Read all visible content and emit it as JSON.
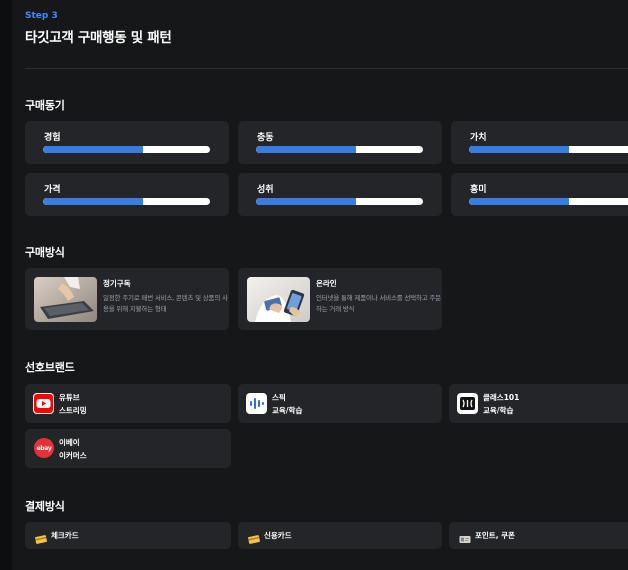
{
  "header": {
    "step": "Step 3",
    "title": "타깃고객 구매행동 및 패턴"
  },
  "motives": {
    "title": "구매동기",
    "items": [
      {
        "label": "경험",
        "level": 0.6
      },
      {
        "label": "충동",
        "level": 0.6
      },
      {
        "label": "가치",
        "level": 0.6
      },
      {
        "label": "가격",
        "level": 0.6
      },
      {
        "label": "성취",
        "level": 0.6
      },
      {
        "label": "흥미",
        "level": 0.6
      }
    ]
  },
  "methods": {
    "title": "구매방식",
    "items": [
      {
        "title": "정기구독",
        "desc": "일정한 주기로 매번 서비스, 콘텐츠 및 상품의 사용을 위해 지불하는 형태",
        "icon": "laptop-photo-icon"
      },
      {
        "title": "온라인",
        "desc": "인터넷을 통해 제품이나 서비스를 선택하고 주문하는 거래 방식",
        "icon": "phone-card-photo-icon"
      }
    ]
  },
  "brands": {
    "title": "선호브랜드",
    "items": [
      {
        "name": "유튜브",
        "category": "스트리밍",
        "icon": "youtube-logo-icon",
        "color": "#ff0000"
      },
      {
        "name": "스픽",
        "category": "교육/학습",
        "icon": "speak-logo-icon",
        "color": "#ffffff"
      },
      {
        "name": "클래스101",
        "category": "교육/학습",
        "icon": "class101-logo-icon",
        "color": "#ffffff"
      },
      {
        "name": "이베이",
        "category": "이커머스",
        "icon": "ebay-logo-icon",
        "color": "#e53238",
        "logo_text": "ebay"
      }
    ]
  },
  "payments": {
    "title": "결제방식",
    "items": [
      {
        "label": "체크카드",
        "icon": "card-icon"
      },
      {
        "label": "신용카드",
        "icon": "card-icon"
      },
      {
        "label": "포인트, 쿠폰",
        "icon": "coupon-icon"
      }
    ]
  },
  "colors": {
    "accent": "#3d8bff",
    "bar": "#3a7de0",
    "card": "#242529",
    "bg": "#161719"
  }
}
